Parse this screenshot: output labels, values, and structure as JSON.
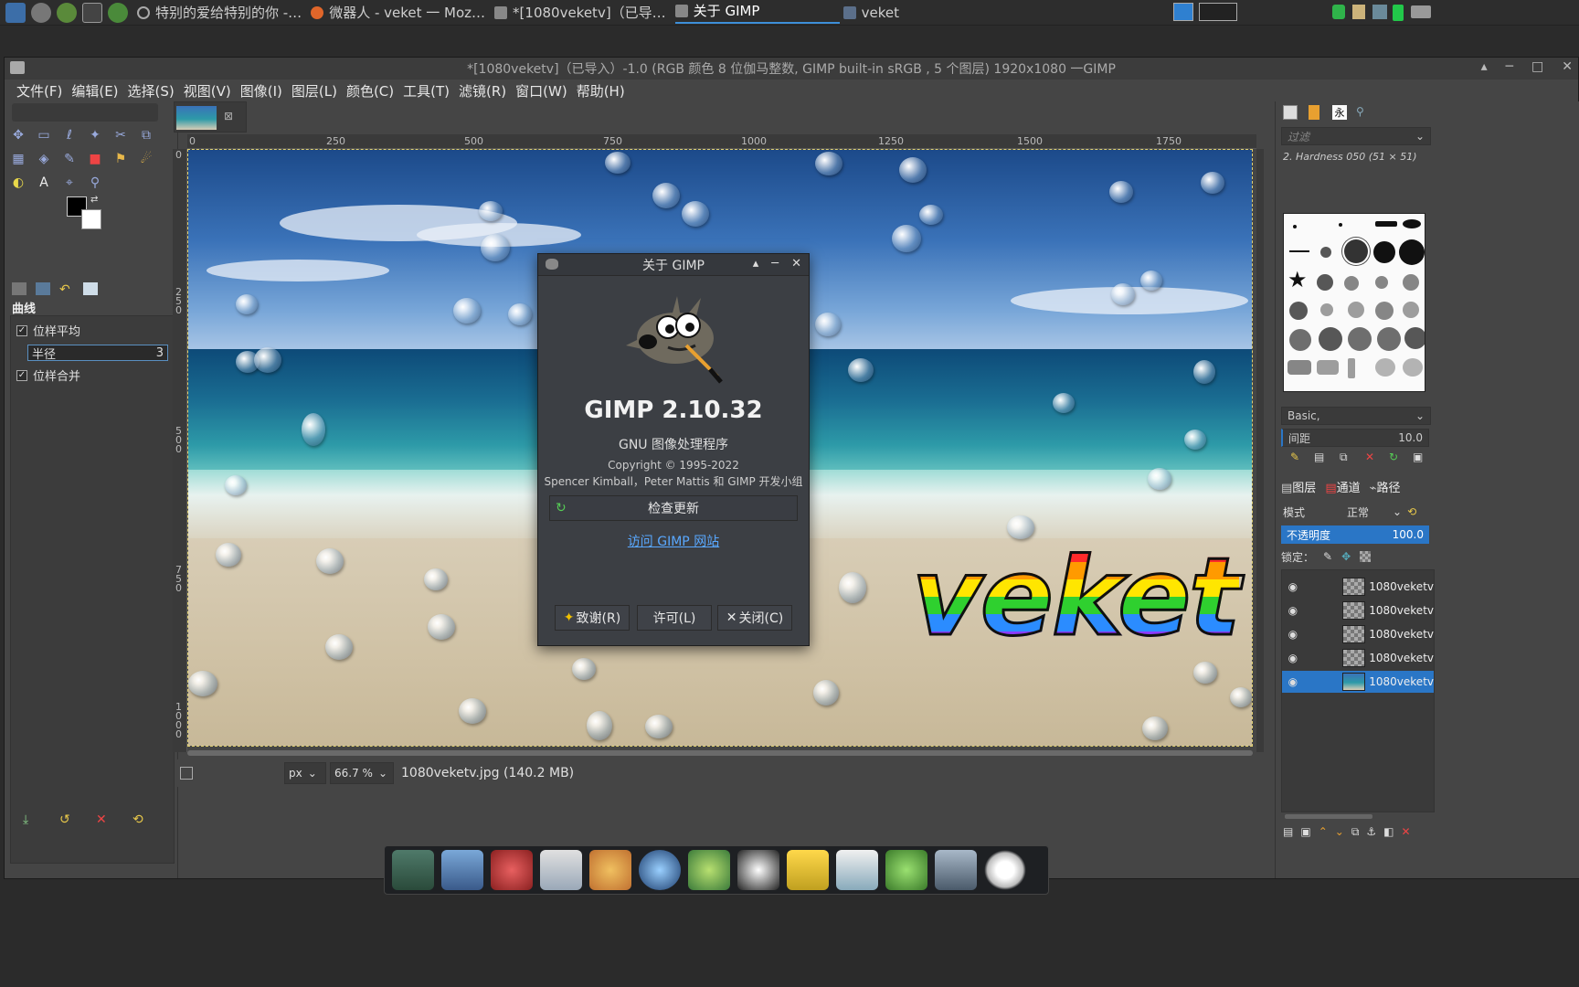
{
  "taskbar": {
    "tasks": [
      {
        "label": "特别的爱给特别的你 -…"
      },
      {
        "label": "微器人 - veket 一 Moz…"
      },
      {
        "label": "*[1080veketv]（已导…"
      },
      {
        "label": "关于 GIMP"
      },
      {
        "label": "veket"
      }
    ]
  },
  "window": {
    "title": "*[1080veketv]（已导入）-1.0 (RGB 颜色 8 位伽马整数, GIMP built-in sRGB , 5 个图层) 1920x1080 一GIMP",
    "buttons": [
      "▴",
      "─",
      "□",
      "✕"
    ]
  },
  "menu": [
    "文件(F)",
    "编辑(E)",
    "选择(S)",
    "视图(V)",
    "图像(I)",
    "图层(L)",
    "颜色(C)",
    "工具(T)",
    "滤镜(R)",
    "窗口(W)",
    "帮助(H)"
  ],
  "tool_options": {
    "title": "曲线",
    "sample_average_label": "位样平均",
    "sample_average_checked": true,
    "radius_label": "半径",
    "radius_value": "3",
    "sample_merged_label": "位样合并",
    "sample_merged_checked": true
  },
  "ruler": {
    "h_ticks": [
      "0",
      "250",
      "500",
      "750",
      "1000",
      "1250",
      "1500",
      "1750"
    ],
    "v_ticks": [
      "0",
      "2\n5\n0",
      "5\n0\n0",
      "7\n5\n0",
      "1\n0\n0\n0"
    ]
  },
  "statusbar": {
    "unit": "px",
    "zoom": "66.7 %",
    "file_info": "1080veketv.jpg (140.2 MB)"
  },
  "canvas": {
    "overlay_text": "veket"
  },
  "brushes": {
    "filter_placeholder": "过滤",
    "selected_brush": "2. Hardness 050 (51 × 51)",
    "preset": "Basic,",
    "spacing_label": "间距",
    "spacing_value": "10.0"
  },
  "layers": {
    "tabs": [
      "图层",
      "通道",
      "路径"
    ],
    "mode_label": "模式",
    "mode_value": "正常",
    "opacity_label": "不透明度",
    "opacity_value": "100.0",
    "lock_label": "锁定：",
    "items": [
      {
        "name": "1080veketv",
        "selected": false
      },
      {
        "name": "1080veketv",
        "selected": false
      },
      {
        "name": "1080veketv",
        "selected": false
      },
      {
        "name": "1080veketv",
        "selected": false
      },
      {
        "name": "1080veketv",
        "selected": true
      }
    ]
  },
  "about_dialog": {
    "title": "关于 GIMP",
    "version": "GIMP 2.10.32",
    "subtitle": "GNU 图像处理程序",
    "copyright": "Copyright © 1995-2022",
    "authors": "Spencer Kimball，Peter Mattis 和 GIMP 开发小组",
    "check_update": "检查更新",
    "visit_site": "访问 GIMP 网站",
    "credits_button": "致谢(R)",
    "license_button": "许可(L)",
    "close_button": "关闭(C)"
  },
  "colors": {
    "accent": "#2a76c6",
    "link": "#59a8ff"
  }
}
